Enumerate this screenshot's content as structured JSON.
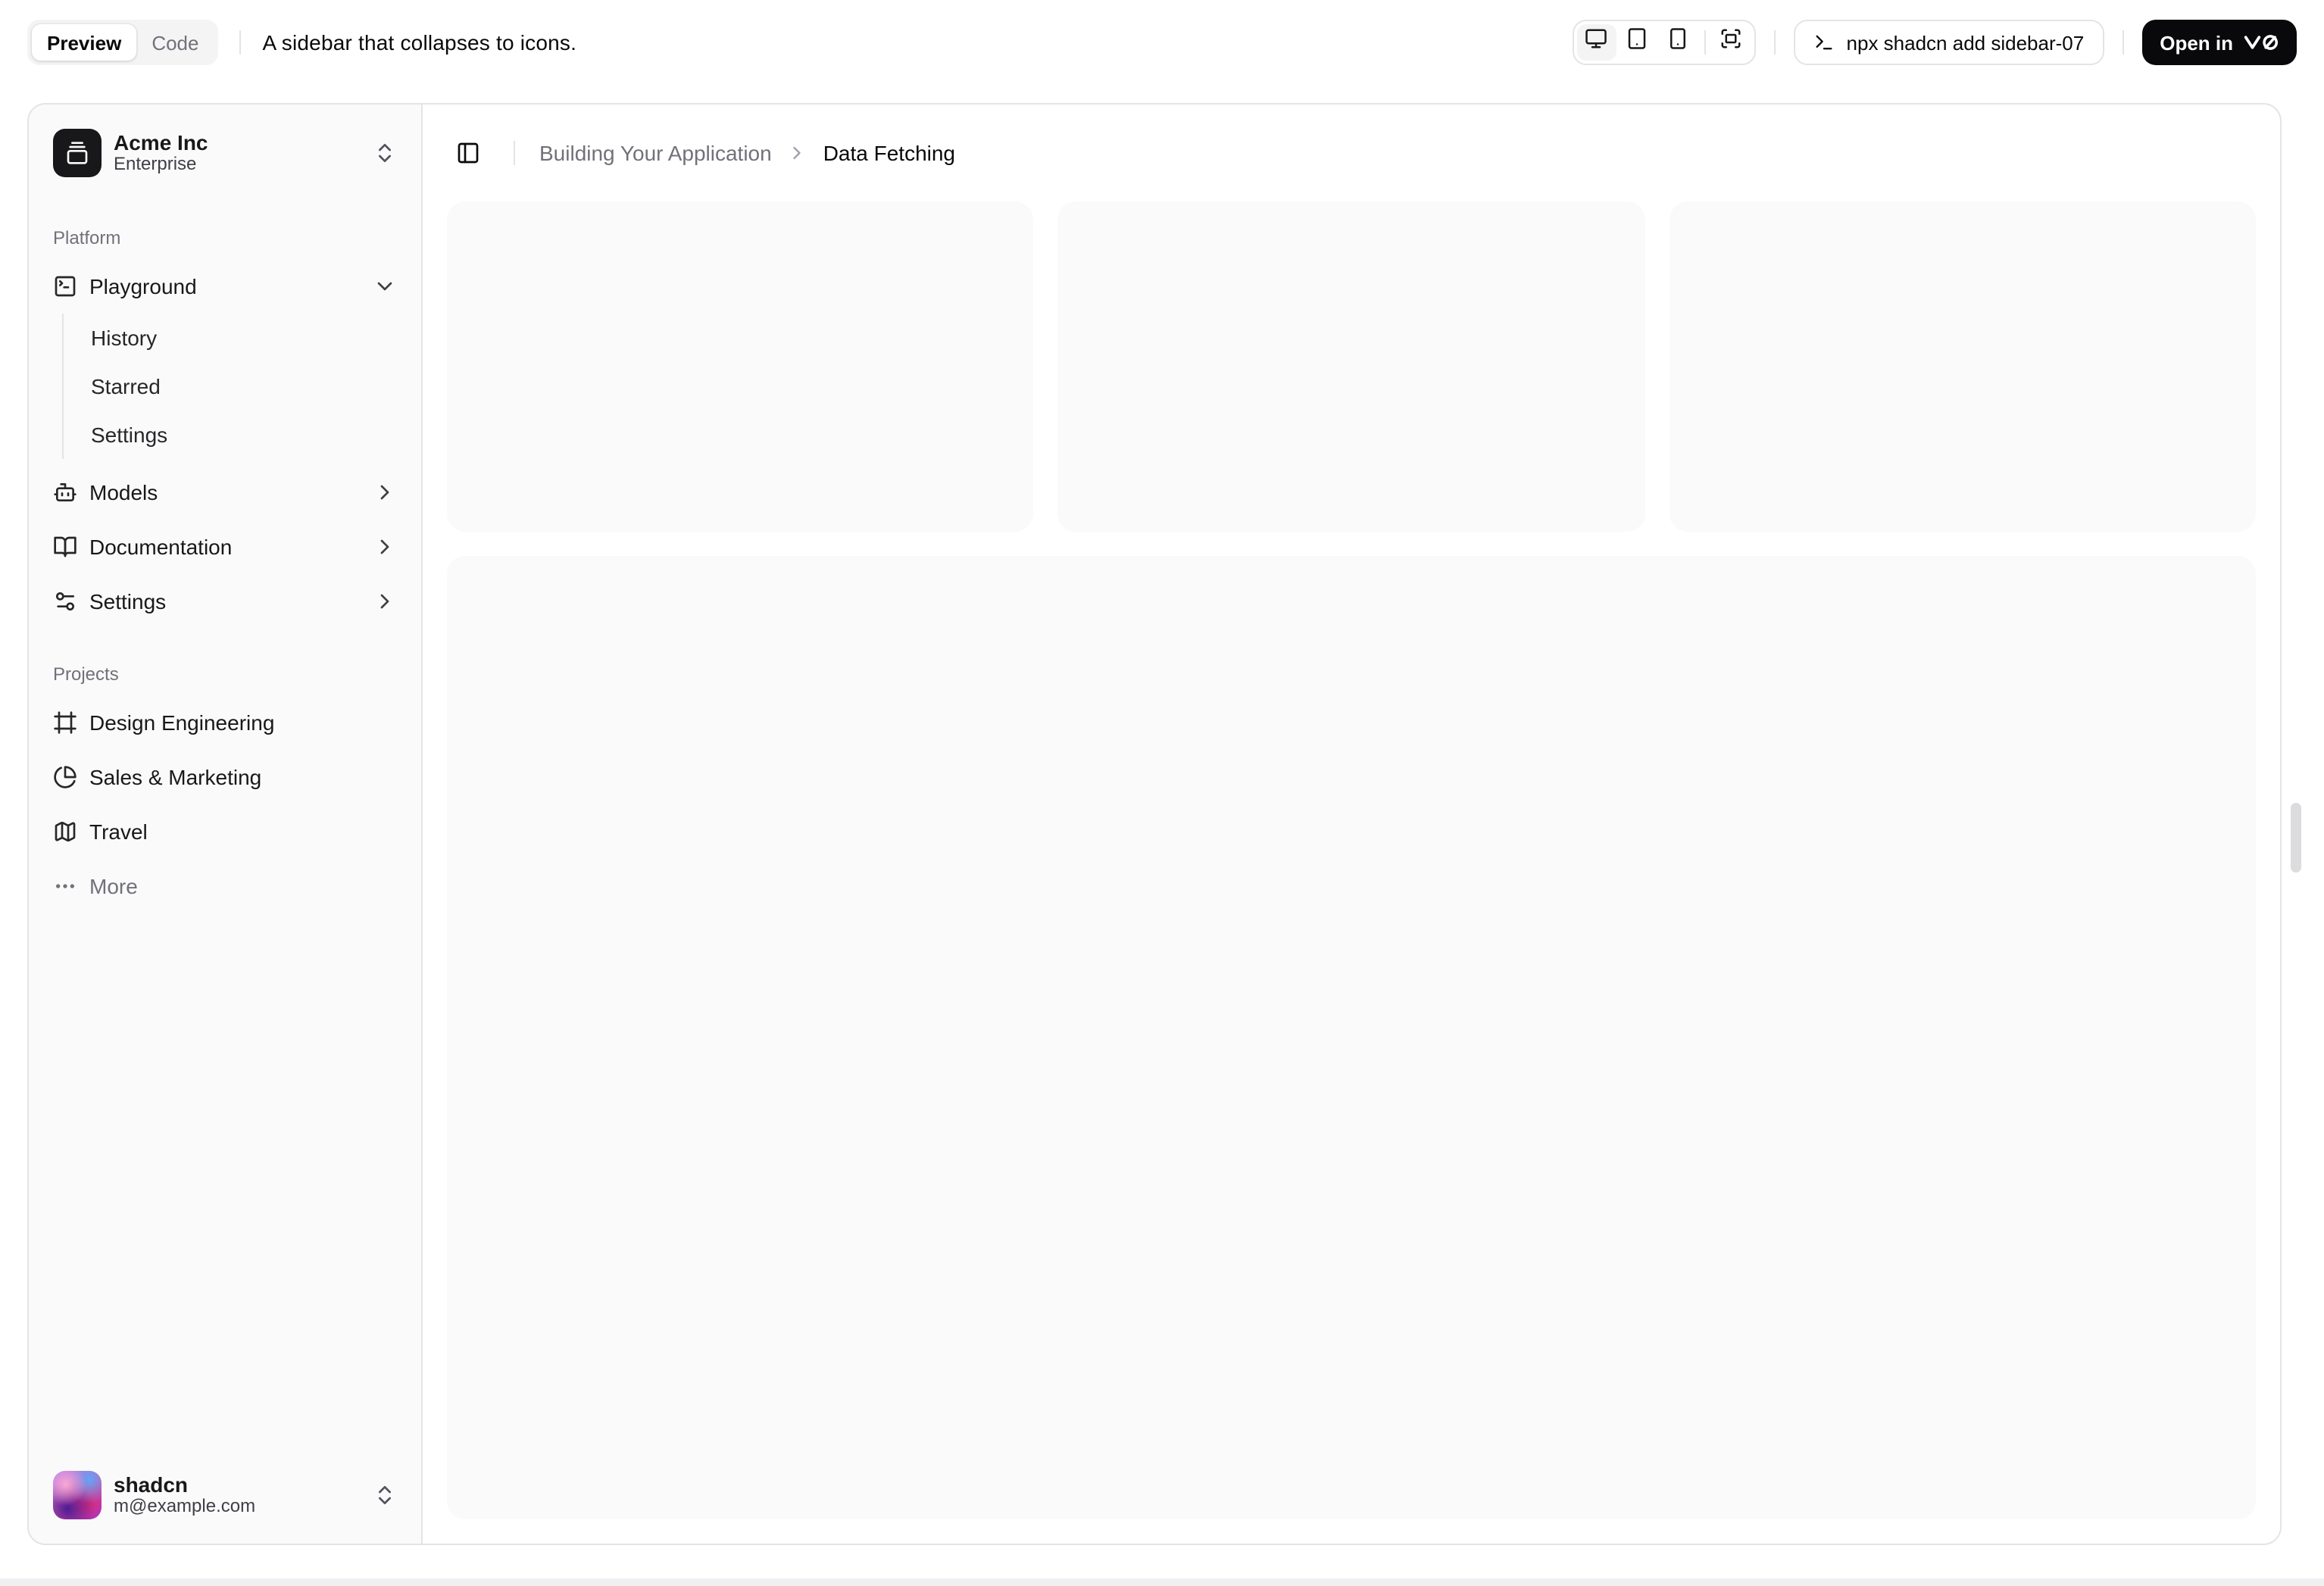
{
  "colors": {
    "primary": "#09090b",
    "border": "#e4e4e7",
    "sidebar_background": "#fafafa",
    "muted_background": "#f4f4f5",
    "placeholder_background": "#fafafa",
    "muted_text": "#71717a",
    "text": "#09090b",
    "open_button_background": "#09090b",
    "open_button_text": "#ffffff"
  },
  "toolbar": {
    "tabs": {
      "preview": "Preview",
      "code": "Code"
    },
    "title": "A sidebar that collapses to icons.",
    "command": "npx shadcn add sidebar-07",
    "open_in": "Open in"
  },
  "sidebar": {
    "team": {
      "name": "Acme Inc",
      "plan": "Enterprise"
    },
    "groups": [
      {
        "label": "Platform"
      },
      {
        "label": "Projects"
      }
    ],
    "platform_items": [
      "Playground",
      "Models",
      "Documentation",
      "Settings"
    ],
    "playground_children": [
      "History",
      "Starred",
      "Settings"
    ],
    "project_items": [
      "Design Engineering",
      "Sales & Marketing",
      "Travel",
      "More"
    ],
    "user": {
      "name": "shadcn",
      "email": "m@example.com"
    }
  },
  "breadcrumb": {
    "section": "Building Your Application",
    "page": "Data Fetching"
  },
  "icons": {
    "team-logo-icon": "gallery-vertical-end",
    "playground-icon": "square-terminal",
    "models-icon": "bot",
    "documentation-icon": "book-open",
    "settings-icon": "sliders",
    "design-engineering-icon": "frame",
    "sales-marketing-icon": "pie-chart",
    "travel-icon": "map",
    "more-icon": "ellipsis",
    "expand-icon": "chevrons-up-down",
    "collapse-icon": "chevron-down",
    "submenu-icon": "chevron-right",
    "sidebar-toggle-icon": "panel-left",
    "desktop-icon": "monitor",
    "tablet-icon": "tablet",
    "mobile-icon": "smartphone",
    "fullscreen-icon": "fullscreen",
    "terminal-icon": "terminal",
    "v0-logo-icon": "v0"
  }
}
